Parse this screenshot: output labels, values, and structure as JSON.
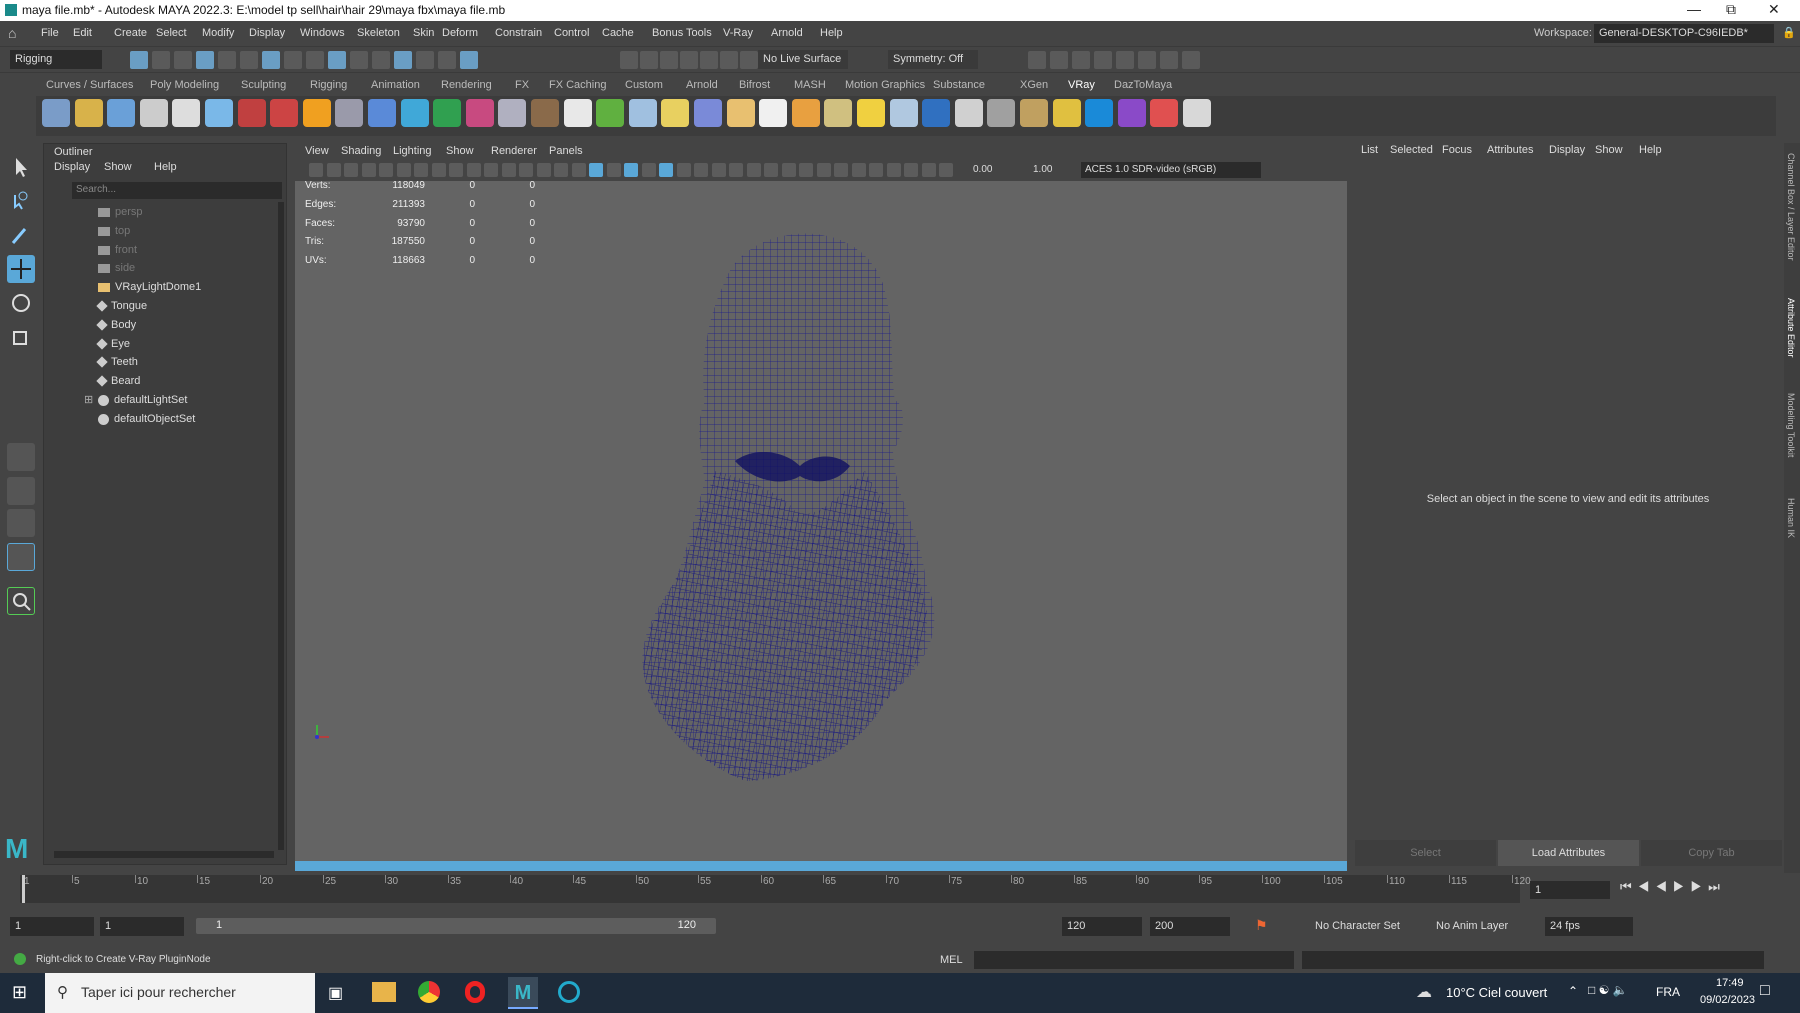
{
  "window": {
    "title": "maya file.mb* - Autodesk MAYA 2022.3: E:\\model tp sell\\hair\\hair 29\\maya fbx\\maya file.mb"
  },
  "menus": [
    "File",
    "Edit",
    "Create",
    "Select",
    "Modify",
    "Display",
    "Windows",
    "Skeleton",
    "Skin",
    "Deform",
    "Constrain",
    "Control",
    "Cache",
    "Bonus Tools",
    "V-Ray",
    "Arnold",
    "Help"
  ],
  "workspace": {
    "label": "Workspace:",
    "value": "General-DESKTOP-C96IEDB*"
  },
  "statusline": {
    "mode": "Rigging",
    "live_surface": "No Live Surface",
    "symmetry": "Symmetry: Off"
  },
  "shelf_tabs": [
    "Curves / Surfaces",
    "Poly Modeling",
    "Sculpting",
    "Rigging",
    "Animation",
    "Rendering",
    "FX",
    "FX Caching",
    "Custom",
    "Arnold",
    "Bifrost",
    "MASH",
    "Motion Graphics",
    "Substance",
    "XGen",
    "VRay",
    "DazToMaya"
  ],
  "shelf_active": "VRay",
  "outliner": {
    "title": "Outliner",
    "menus": [
      "Display",
      "Show",
      "Help"
    ],
    "search_placeholder": "Search...",
    "items": [
      {
        "label": "persp",
        "type": "camera",
        "dim": true
      },
      {
        "label": "top",
        "type": "camera",
        "dim": true
      },
      {
        "label": "front",
        "type": "camera",
        "dim": true
      },
      {
        "label": "side",
        "type": "camera",
        "dim": true
      },
      {
        "label": "VRayLightDome1",
        "type": "light",
        "dim": false
      },
      {
        "label": "Tongue",
        "type": "mesh",
        "dim": false
      },
      {
        "label": "Body",
        "type": "mesh",
        "dim": false
      },
      {
        "label": "Eye",
        "type": "mesh",
        "dim": false
      },
      {
        "label": "Teeth",
        "type": "mesh",
        "dim": false
      },
      {
        "label": "Beard",
        "type": "mesh",
        "dim": false
      },
      {
        "label": "defaultLightSet",
        "type": "set",
        "dim": false
      },
      {
        "label": "defaultObjectSet",
        "type": "set",
        "dim": false
      }
    ]
  },
  "viewport": {
    "menus": [
      "View",
      "Shading",
      "Lighting",
      "Show",
      "Renderer",
      "Panels"
    ],
    "exposure": "0.00",
    "gamma": "1.00",
    "color_space": "ACES 1.0 SDR-video (sRGB)",
    "hud": [
      {
        "label": "Verts:",
        "v": "118049",
        "a": "0",
        "b": "0"
      },
      {
        "label": "Edges:",
        "v": "211393",
        "a": "0",
        "b": "0"
      },
      {
        "label": "Faces:",
        "v": "93790",
        "a": "0",
        "b": "0"
      },
      {
        "label": "Tris:",
        "v": "187550",
        "a": "0",
        "b": "0"
      },
      {
        "label": "UVs:",
        "v": "118663",
        "a": "0",
        "b": "0"
      }
    ]
  },
  "attribute_editor": {
    "menus": [
      "List",
      "Selected",
      "Focus",
      "Attributes",
      "Display",
      "Show",
      "Help"
    ],
    "message": "Select an object in the scene to view and edit its attributes",
    "buttons": [
      "Select",
      "Load Attributes",
      "Copy Tab"
    ]
  },
  "side_tabs": [
    "Channel Box / Layer Editor",
    "Attribute Editor",
    "Modeling Toolkit",
    "Human IK"
  ],
  "timeline": {
    "ticks": [
      "1",
      "5",
      "10",
      "15",
      "20",
      "25",
      "30",
      "35",
      "40",
      "45",
      "50",
      "55",
      "60",
      "65",
      "70",
      "75",
      "80",
      "85",
      "90",
      "95",
      "100",
      "105",
      "110",
      "115",
      "120"
    ],
    "current": "1"
  },
  "range": {
    "start": "1",
    "start2": "1",
    "slider_start": "1",
    "slider_end": "120",
    "end": "120",
    "end2": "200",
    "character_set": "No Character Set",
    "anim_layer": "No Anim Layer",
    "fps": "24 fps"
  },
  "command": {
    "help": "Right-click to Create V-Ray PluginNode",
    "lang": "MEL"
  },
  "taskbar": {
    "search": "Taper ici pour rechercher",
    "weather": "10°C  Ciel couvert",
    "lang": "FRA",
    "time": "17:49",
    "date": "09/02/2023"
  },
  "colors": {
    "wire": "#1a1a8a",
    "accent": "#5aa8d8"
  }
}
